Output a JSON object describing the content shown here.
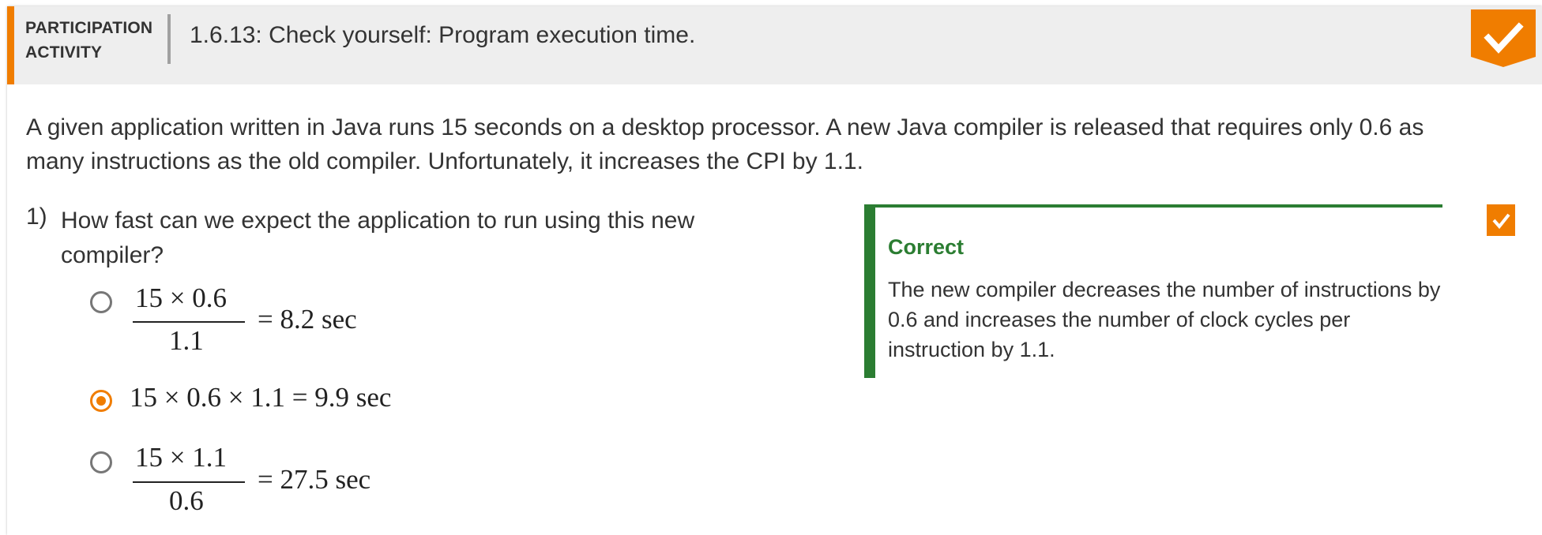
{
  "header": {
    "badge_line1": "PARTICIPATION",
    "badge_line2": "ACTIVITY",
    "title": "1.6.13: Check yourself: Program execution time."
  },
  "prompt": "A given application written in Java runs 15 seconds on a desktop processor. A new Java compiler is released that requires only 0.6 as many instructions as the old compiler. Unfortunately, it increases the CPI by 1.1.",
  "question": {
    "number": "1)",
    "text": "How fast can we expect the application to run using this new compiler?",
    "options": [
      {
        "numerator": "15 × 0.6",
        "denominator": "1.1",
        "result": "= 8.2 sec",
        "selected": false
      },
      {
        "expression": "15 × 0.6 × 1.1 = 9.9 sec",
        "selected": true
      },
      {
        "numerator": "15 × 1.1",
        "denominator": "0.6",
        "result": "= 27.5 sec",
        "selected": false
      }
    ]
  },
  "feedback": {
    "title": "Correct",
    "text": "The new compiler decreases the number of instructions by 0.6 and increases the number of clock cycles per instruction by 1.1."
  },
  "colors": {
    "accent": "#f07d00",
    "correct": "#2b7d32",
    "header_bg": "#eeeeee"
  },
  "icons": {
    "activity_complete": "check-icon",
    "question_complete": "check-icon"
  }
}
